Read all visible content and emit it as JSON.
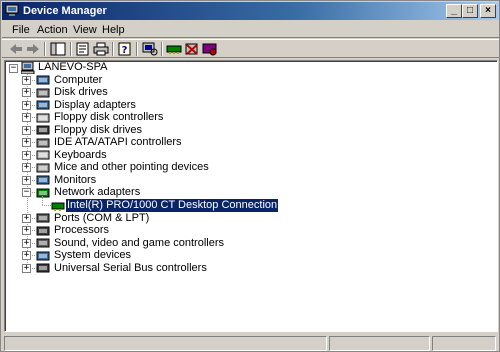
{
  "window": {
    "title": "Device Manager",
    "controls": {
      "minimize": "_",
      "maximize": "□",
      "close": "×"
    }
  },
  "menu": [
    "File",
    "Action",
    "View",
    "Help"
  ],
  "toolbar": {
    "icons": [
      "back-icon",
      "forward-icon",
      "show-hide-tree-icon",
      "properties-icon",
      "print-icon",
      "help-icon",
      "scan-hardware-icon",
      "update-driver-icon",
      "uninstall-icon",
      "disable-icon"
    ]
  },
  "tree": {
    "root": "LANEVO-SPA",
    "items": [
      {
        "label": "Computer",
        "expander": "+",
        "icon": "computer-icon"
      },
      {
        "label": "Disk drives",
        "expander": "+",
        "icon": "disk-drive-icon"
      },
      {
        "label": "Display adapters",
        "expander": "+",
        "icon": "display-adapter-icon"
      },
      {
        "label": "Floppy disk controllers",
        "expander": "+",
        "icon": "floppy-controller-icon"
      },
      {
        "label": "Floppy disk drives",
        "expander": "+",
        "icon": "floppy-drive-icon"
      },
      {
        "label": "IDE ATA/ATAPI controllers",
        "expander": "+",
        "icon": "ide-controller-icon"
      },
      {
        "label": "Keyboards",
        "expander": "+",
        "icon": "keyboard-icon"
      },
      {
        "label": "Mice and other pointing devices",
        "expander": "+",
        "icon": "mouse-icon"
      },
      {
        "label": "Monitors",
        "expander": "+",
        "icon": "monitor-icon"
      },
      {
        "label": "Network adapters",
        "expander": "−",
        "icon": "network-adapter-icon",
        "children": [
          {
            "label": "Intel(R) PRO/1000 CT Desktop Connection",
            "selected": true,
            "icon": "network-card-icon"
          }
        ]
      },
      {
        "label": "Ports (COM & LPT)",
        "expander": "+",
        "icon": "port-icon"
      },
      {
        "label": "Processors",
        "expander": "+",
        "icon": "processor-icon"
      },
      {
        "label": "Sound, video and game controllers",
        "expander": "+",
        "icon": "sound-icon"
      },
      {
        "label": "System devices",
        "expander": "+",
        "icon": "system-device-icon"
      },
      {
        "label": "Universal Serial Bus controllers",
        "expander": "+",
        "icon": "usb-icon"
      }
    ]
  },
  "colors": {
    "titlebar": "#0a246a",
    "chrome": "#d4d0c8",
    "selection": "#0a246a"
  }
}
